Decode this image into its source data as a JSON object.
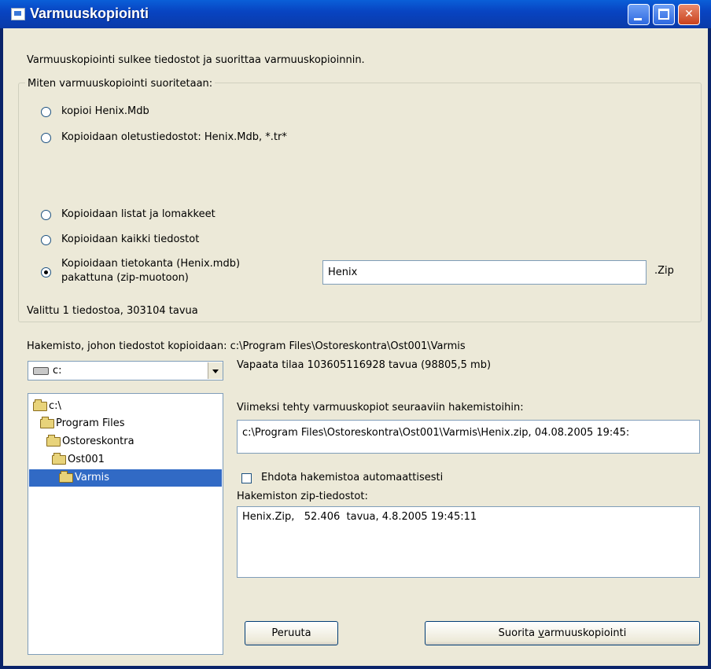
{
  "window": {
    "title": "Varmuuskopiointi"
  },
  "intro_text": "Varmuuskopiointi sulkee tiedostot ja suorittaa varmuuskopioinnin.",
  "method_frame": {
    "label": "Miten varmuuskopiointi suoritetaan:",
    "options": [
      {
        "label": "kopioi Henix.Mdb",
        "selected": false
      },
      {
        "label": "Kopioidaan oletustiedostot: Henix.Mdb, *.tr*",
        "selected": false
      },
      {
        "label": "Kopioidaan listat ja lomakkeet",
        "selected": false
      },
      {
        "label": "Kopioidaan kaikki tiedostot",
        "selected": false
      },
      {
        "label_line1": "Kopioidaan tietokanta (Henix.mdb)",
        "label_line2": "pakattuna (zip-muotoon)",
        "selected": true
      }
    ],
    "zip_name_value": "Henix",
    "zip_extension": ".Zip"
  },
  "selection_summary": "Valittu 1 tiedostoa, 303104 tavua",
  "target_dir_text": "Hakemisto, johon tiedostot kopioidaan: c:\\Program Files\\Ostoreskontra\\Ost001\\Varmis",
  "drive_select": {
    "value": "c:"
  },
  "free_space": "Vapaata tilaa 103605116928 tavua (98805,5 mb)",
  "folder_tree": [
    {
      "label": "c:\\",
      "selected": false
    },
    {
      "label": "Program Files",
      "selected": false
    },
    {
      "label": "Ostoreskontra",
      "selected": false
    },
    {
      "label": "Ost001",
      "selected": false
    },
    {
      "label": "Varmis",
      "selected": true
    }
  ],
  "last_backup": {
    "label": "Viimeksi tehty varmuuskopiot seuraaviin hakemistoihin:",
    "value": "c:\\Program Files\\Ostoreskontra\\Ost001\\Varmis\\Henix.zip, 04.08.2005 19:45:"
  },
  "auto_dir_checkbox": {
    "label": "Ehdota hakemistoa automaattisesti",
    "checked": false
  },
  "zip_files": {
    "label": "Hakemiston zip-tiedostot:",
    "value": "Henix.Zip,   52.406  tavua, 4.8.2005 19:45:11"
  },
  "buttons": {
    "cancel": "Peruuta",
    "run_prefix": "Suorita ",
    "run_accel": "v",
    "run_suffix": "armuuskopiointi"
  }
}
